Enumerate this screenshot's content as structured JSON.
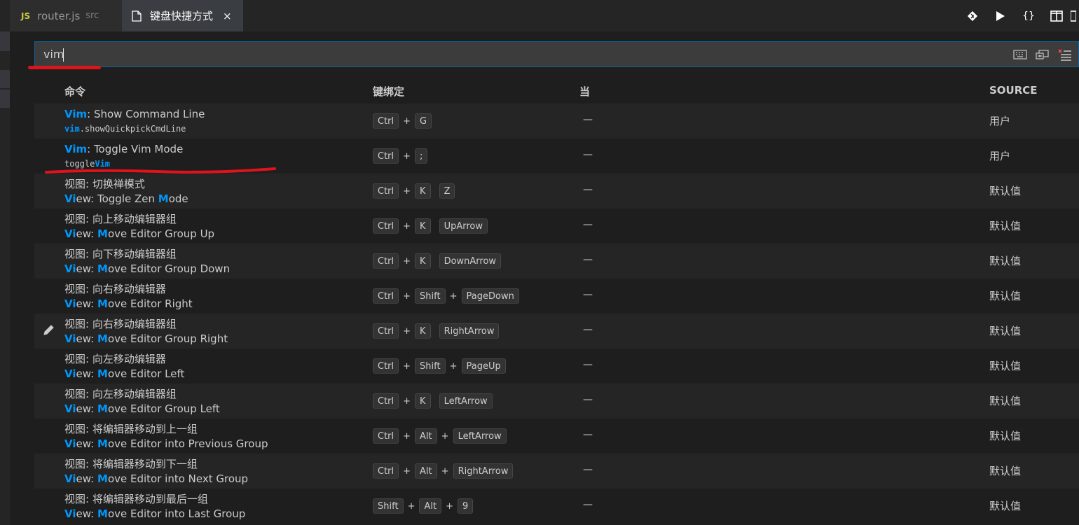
{
  "tabs": {
    "router": {
      "badge": "JS",
      "label": "router.js",
      "dir": "src"
    },
    "keybindings": {
      "label": "键盘快捷方式",
      "close": "×"
    }
  },
  "toolbar": {
    "braces": "{}"
  },
  "search": {
    "value": "vim",
    "placeholder": ""
  },
  "columns": {
    "command": "命令",
    "keybinding": "键绑定",
    "when": "当",
    "source": "SOURCE"
  },
  "rows": [
    {
      "title_hl": "Vim",
      "title_rest": ": Show Command Line",
      "sub_hl": "vim",
      "sub_rest": ".showQuickpickCmdLine",
      "sub_mono": true,
      "keys": [
        [
          "Ctrl",
          "G"
        ]
      ],
      "when": "—",
      "source": "用户"
    },
    {
      "title_hl": "Vim",
      "title_rest": ": Toggle Vim Mode",
      "sub_pre": "toggle",
      "sub_hl2": "Vim",
      "sub_mono": true,
      "keys": [
        [
          "Ctrl",
          ";"
        ]
      ],
      "when": "—",
      "source": "用户"
    },
    {
      "title_plain": "视图: 切换禅模式",
      "sub_parts": [
        "Vi",
        "ew: Toggle Zen ",
        "M",
        "ode"
      ],
      "keys": [
        [
          "Ctrl",
          "K"
        ],
        [
          "Z"
        ]
      ],
      "when": "—",
      "source": "默认值"
    },
    {
      "title_plain": "视图: 向上移动编辑器组",
      "sub_parts": [
        "Vi",
        "ew: ",
        "M",
        "ove Editor Group Up"
      ],
      "keys": [
        [
          "Ctrl",
          "K"
        ],
        [
          "UpArrow"
        ]
      ],
      "when": "—",
      "source": "默认值"
    },
    {
      "title_plain": "视图: 向下移动编辑器组",
      "sub_parts": [
        "Vi",
        "ew: ",
        "M",
        "ove Editor Group Down"
      ],
      "keys": [
        [
          "Ctrl",
          "K"
        ],
        [
          "DownArrow"
        ]
      ],
      "when": "—",
      "source": "默认值"
    },
    {
      "title_plain": "视图: 向右移动编辑器",
      "sub_parts": [
        "Vi",
        "ew: ",
        "M",
        "ove Editor Right"
      ],
      "keys": [
        [
          "Ctrl",
          "Shift",
          "PageDown"
        ]
      ],
      "when": "—",
      "source": "默认值"
    },
    {
      "title_plain": "视图: 向右移动编辑器组",
      "sub_parts": [
        "Vi",
        "ew: ",
        "M",
        "ove Editor Group Right"
      ],
      "keys": [
        [
          "Ctrl",
          "K"
        ],
        [
          "RightArrow"
        ]
      ],
      "when": "—",
      "source": "默认值",
      "editing": true
    },
    {
      "title_plain": "视图: 向左移动编辑器",
      "sub_parts": [
        "Vi",
        "ew: ",
        "M",
        "ove Editor Left"
      ],
      "keys": [
        [
          "Ctrl",
          "Shift",
          "PageUp"
        ]
      ],
      "when": "—",
      "source": "默认值"
    },
    {
      "title_plain": "视图: 向左移动编辑器组",
      "sub_parts": [
        "Vi",
        "ew: ",
        "M",
        "ove Editor Group Left"
      ],
      "keys": [
        [
          "Ctrl",
          "K"
        ],
        [
          "LeftArrow"
        ]
      ],
      "when": "—",
      "source": "默认值"
    },
    {
      "title_plain": "视图: 将编辑器移动到上一组",
      "sub_parts": [
        "Vi",
        "ew: ",
        "M",
        "ove Editor into Previous Group"
      ],
      "keys": [
        [
          "Ctrl",
          "Alt",
          "LeftArrow"
        ]
      ],
      "when": "—",
      "source": "默认值"
    },
    {
      "title_plain": "视图: 将编辑器移动到下一组",
      "sub_parts": [
        "Vi",
        "ew: ",
        "M",
        "ove Editor into Next Group"
      ],
      "keys": [
        [
          "Ctrl",
          "Alt",
          "RightArrow"
        ]
      ],
      "when": "—",
      "source": "默认值"
    },
    {
      "title_plain": "视图: 将编辑器移动到最后一组",
      "sub_parts": [
        "Vi",
        "ew: ",
        "M",
        "ove Editor into Last Group"
      ],
      "keys": [
        [
          "Shift",
          "Alt",
          "9"
        ]
      ],
      "when": "—",
      "source": "默认值"
    }
  ],
  "colors": {
    "accent": "#0097fb",
    "annotation": "#e0131b",
    "focus_border": "#0e639c"
  },
  "icons": [
    "file-icon",
    "git-compare-icon",
    "run-icon",
    "braces-icon",
    "split-editor-icon",
    "keyboard-icon",
    "sort-by-precedence-icon",
    "clear-filter-icon",
    "edit-pencil-icon"
  ]
}
